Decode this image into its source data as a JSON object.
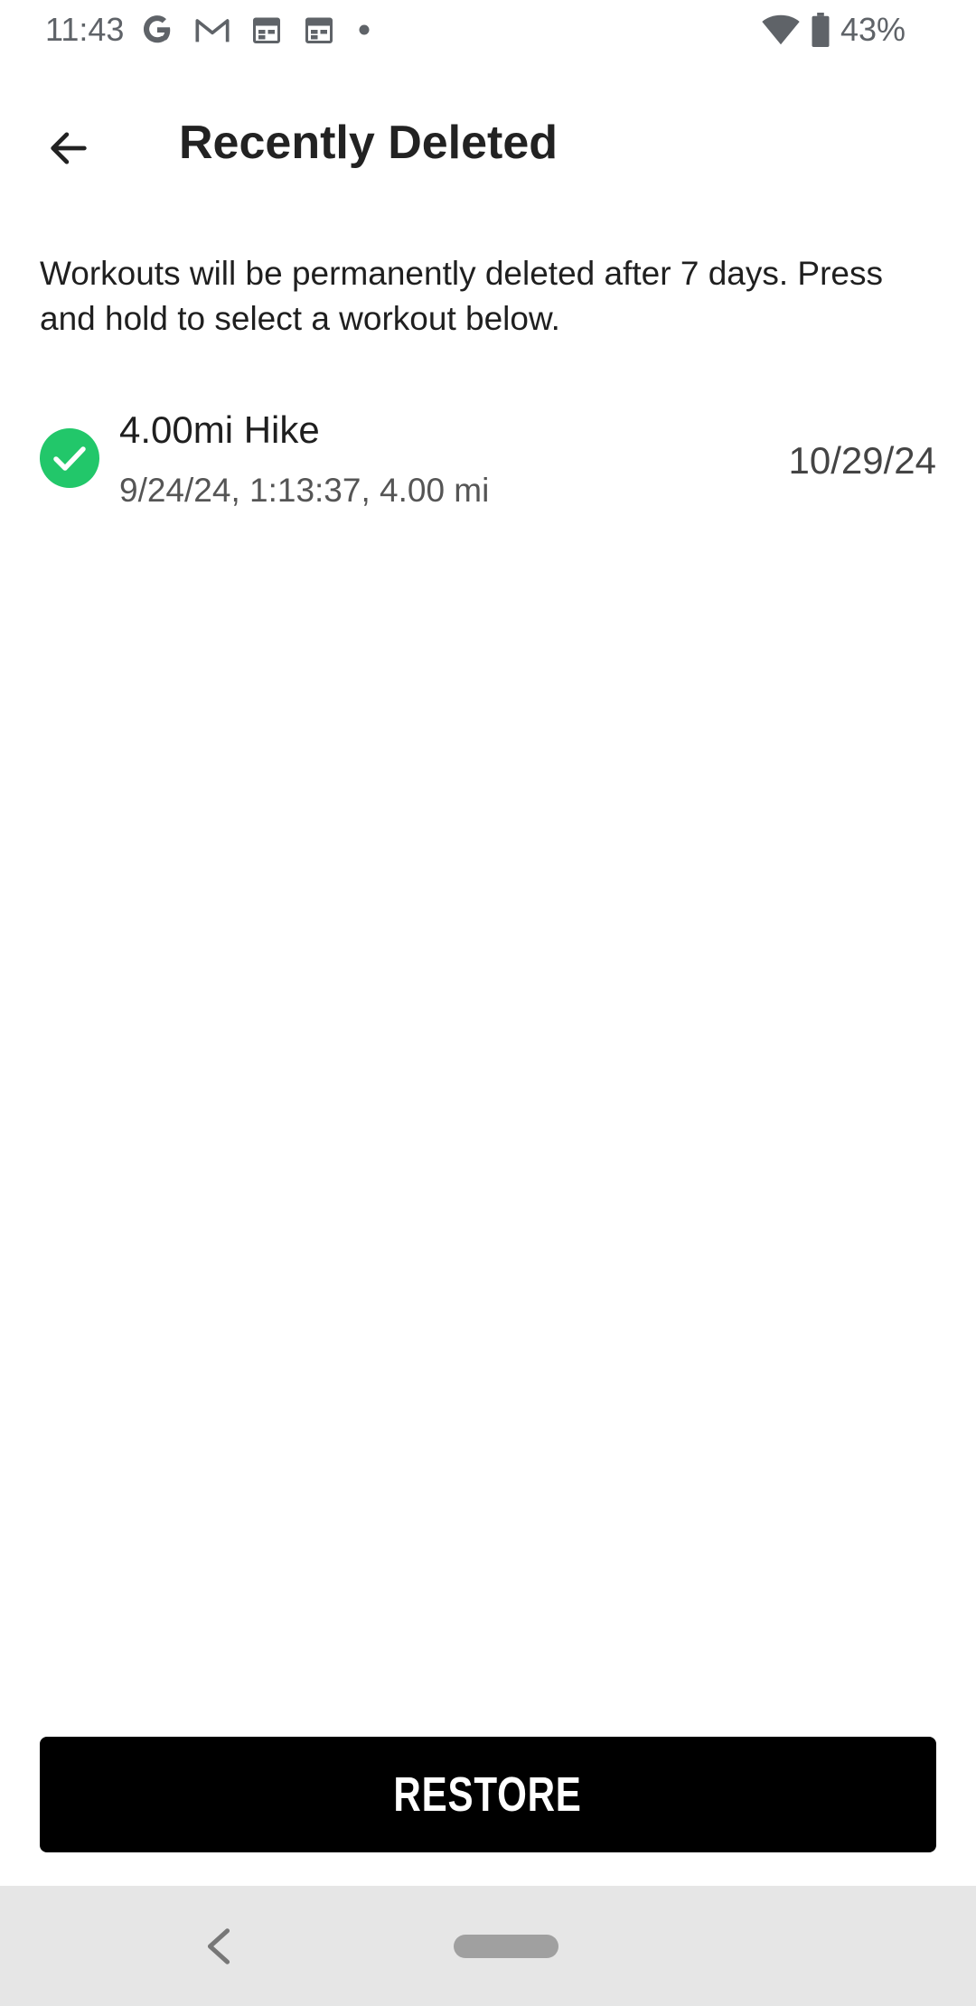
{
  "status_bar": {
    "time": "11:43",
    "battery": "43%",
    "icons": [
      "google-icon",
      "gmail-icon",
      "calendar-icon",
      "calendar-icon",
      "dot-icon",
      "wifi-icon",
      "battery-icon"
    ]
  },
  "header": {
    "title": "Recently Deleted"
  },
  "info": {
    "text": "Workouts will be permanently deleted after 7 days. Press and hold to select a workout below."
  },
  "workouts": [
    {
      "title": "4.00mi Hike",
      "subtitle": "9/24/24, 1:13:37,  4.00 mi",
      "deleted_date": "10/29/24",
      "selected": true
    }
  ],
  "actions": {
    "restore_label": "RESTORE"
  },
  "colors": {
    "accent_green": "#22c76a",
    "button_bg": "#000000",
    "nav_bar_bg": "#e6e6e6"
  }
}
